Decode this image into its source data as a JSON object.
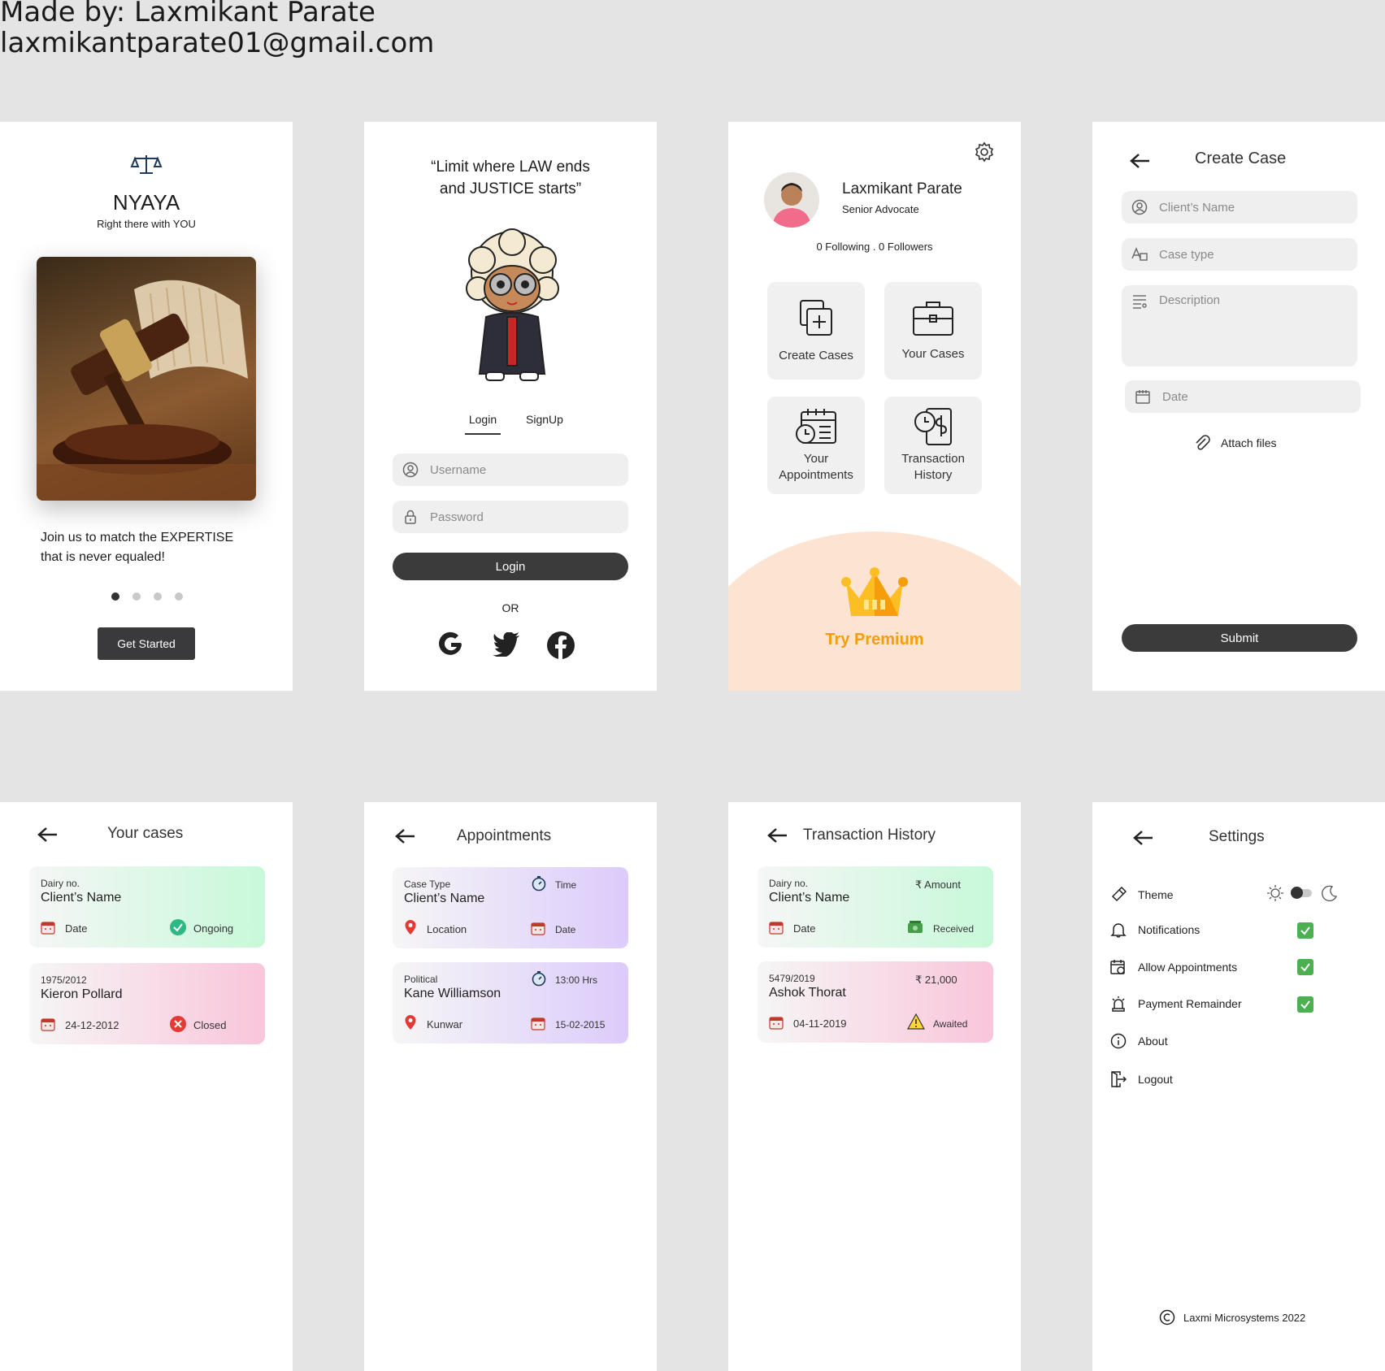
{
  "credit": {
    "line1": "Made by: Laxmikant Parate",
    "line2": "laxmikantparate01@gmail.com"
  },
  "onboarding": {
    "brand": "NYAYA",
    "tagline": "Right there with YOU",
    "message_l1": "Join us to match the EXPERTISE",
    "message_l2": "that is never equaled!",
    "cta": "Get Started",
    "pages_total": 4,
    "page_active": 1
  },
  "login": {
    "quote_l1": "“Limit where LAW ends",
    "quote_l2": "and JUSTICE starts”",
    "tab_login": "Login",
    "tab_signup": "SignUp",
    "username_placeholder": "Username",
    "password_placeholder": "Password",
    "login_button": "Login",
    "or": "OR"
  },
  "dashboard": {
    "name": "Laxmikant Parate",
    "title": "Senior Advocate",
    "follow": "0 Following . 0 Followers",
    "tiles": [
      {
        "l1": "Create Cases",
        "l2": ""
      },
      {
        "l1": "Your Cases",
        "l2": ""
      },
      {
        "l1": "Your",
        "l2": "Appointments"
      },
      {
        "l1": "Transaction",
        "l2": "History"
      }
    ],
    "premium": "Try Premium"
  },
  "create_case": {
    "title": "Create Case",
    "client_name": "Client’s Name",
    "case_type": "Case type",
    "description": "Description",
    "date": "Date",
    "attach": "Attach files",
    "submit": "Submit"
  },
  "your_cases": {
    "title": "Your cases",
    "cards": [
      {
        "top": "Dairy no.",
        "name": "Client’s Name",
        "date": "Date",
        "status": "Ongoing"
      },
      {
        "top": "1975/2012",
        "name": "Kieron Pollard",
        "date": "24-12-2012",
        "status": "Closed"
      }
    ]
  },
  "appointments": {
    "title": "Appointments",
    "cards": [
      {
        "top": "Case Type",
        "name": "Client’s Name",
        "time": "Time",
        "location": "Location",
        "date": "Date"
      },
      {
        "top": "Political",
        "name": "Kane Williamson",
        "time": "13:00 Hrs",
        "location": "Kunwar",
        "date": "15-02-2015"
      }
    ]
  },
  "transactions": {
    "title": "Transaction History",
    "cards": [
      {
        "top": "Dairy no.",
        "name": "Client’s Name",
        "amount": "₹  Amount",
        "date": "Date",
        "status": "Received"
      },
      {
        "top": "5479/2019",
        "name": "Ashok Thorat",
        "amount": "₹ 21,000",
        "date": "04-11-2019",
        "status": "Awaited"
      }
    ]
  },
  "settings": {
    "title": "Settings",
    "items": [
      "Theme",
      "Notifications",
      "Allow Appointments",
      "Payment Remainder",
      "About",
      "Logout"
    ],
    "checked": [
      true,
      true,
      true
    ],
    "footer": "Laxmi Microsystems 2022"
  }
}
